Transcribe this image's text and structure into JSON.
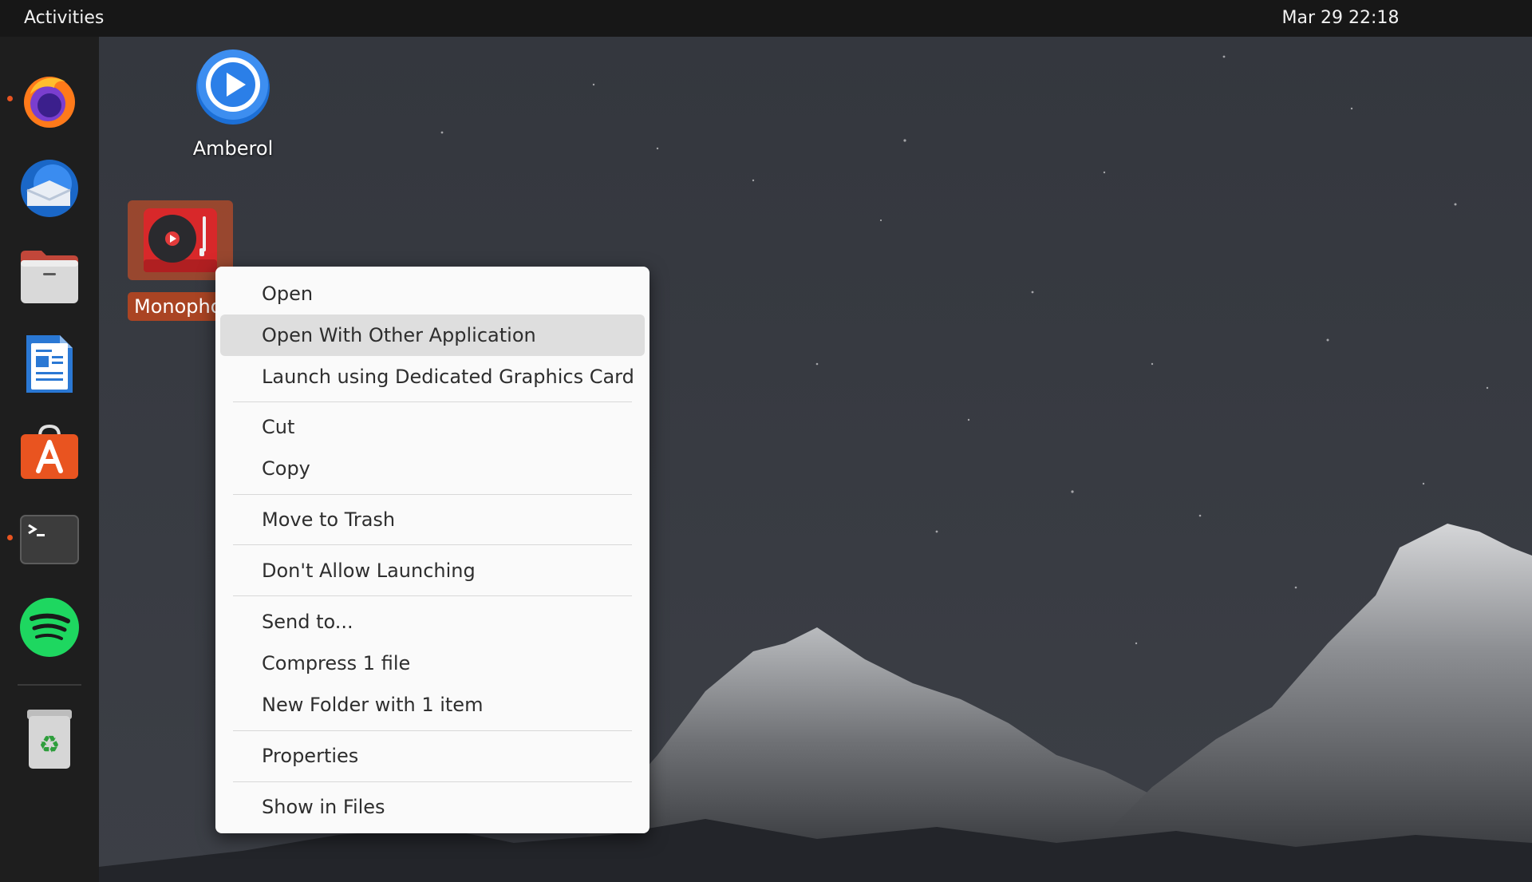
{
  "topbar": {
    "activities_label": "Activities",
    "clock": "Mar 29  22:18"
  },
  "dock": {
    "items": [
      {
        "name": "Firefox",
        "icon": "firefox-icon",
        "running": true
      },
      {
        "name": "Thunderbird",
        "icon": "thunderbird-icon",
        "running": false
      },
      {
        "name": "Files",
        "icon": "files-icon",
        "running": false
      },
      {
        "name": "LibreOffice Writer",
        "icon": "writer-icon",
        "running": false
      },
      {
        "name": "Ubuntu Software",
        "icon": "software-icon",
        "running": false
      },
      {
        "name": "Terminal",
        "icon": "terminal-icon",
        "running": true
      },
      {
        "name": "Spotify",
        "icon": "spotify-icon",
        "running": false
      },
      {
        "name": "Trash",
        "icon": "trash-icon",
        "running": false
      }
    ]
  },
  "desktop": {
    "icons": [
      {
        "label": "Amberol",
        "icon": "amberol-icon",
        "selected": false
      },
      {
        "label": "Monopho",
        "icon": "monophony-icon",
        "selected": true
      }
    ]
  },
  "context_menu": {
    "items": [
      {
        "label": "Open"
      },
      {
        "label": "Open With Other Application",
        "highlighted": true
      },
      {
        "label": "Launch using Dedicated Graphics Card"
      },
      {
        "label": "Cut"
      },
      {
        "label": "Copy"
      },
      {
        "label": "Move to Trash"
      },
      {
        "label": "Don't Allow Launching"
      },
      {
        "label": "Send to..."
      },
      {
        "label": "Compress 1 file"
      },
      {
        "label": "New Folder with 1 item"
      },
      {
        "label": "Properties"
      },
      {
        "label": "Show in Files"
      }
    ]
  },
  "colors": {
    "accent": "#e95420",
    "topbar": "#171717",
    "dock": "#1e1e1e",
    "menu_bg": "#fafafa",
    "menu_hover": "#dedede"
  }
}
